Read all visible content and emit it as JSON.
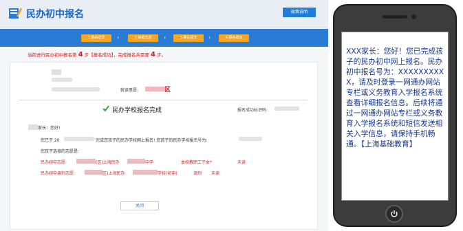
{
  "header": {
    "title": "民办初中报名",
    "help_button": "政策说明"
  },
  "steps": [
    {
      "label": "1.报名登录"
    },
    {
      "label": "2.填报志愿"
    },
    {
      "label": "3.确认提交"
    },
    {
      "label": "4.报名成功"
    }
  ],
  "status": {
    "prefix": "当前进行民办初中报名第",
    "current_step": "4",
    "middle": "步【报名成功】，完成报名共需要",
    "total_steps": "4",
    "suffix": "步。"
  },
  "card": {
    "district_label": "就读意愿:",
    "district_value": "区",
    "done_title": "民办学校报名完成",
    "id_label": "报名成功标识码:",
    "greeting": "家长：您好!",
    "success_prefix": "您已于 20",
    "success_text": "完成您孩子的民办学校网上报名! 您孩子的民办学校报名号为:",
    "choices_label": "您孩子选择的志愿是:",
    "choice1_label": "民办初中志愿:",
    "choice1_school_a": "(区)上海民办",
    "choice1_school_b": "中学",
    "choice1_extra": "本校教职工子女*",
    "choice1_action": "未读",
    "choice2_label": "民办初中调剂志愿:",
    "choice2_school_a": "区)上海民办",
    "choice2_school_b": "学校(初中)",
    "choice2_extra": "调剂",
    "choice2_action": "未读",
    "close_button": "关闭"
  },
  "phone": {
    "sms": "XXX家长：您好！您已完成孩子的民办初中网上报名。民办初中报名号为：XXXXXXXXXX，请及时登录一网通办网站专栏或义务教育入学报名系统查看详细报名信息。后续将通过一网通办网站专栏或义务教育入学报名系统和短信发送相关入学信息，请保持手机畅通。【上海基础教育】"
  },
  "colors": {
    "brand_blue": "#1a66c8",
    "step_bar": "#2a7bd3",
    "step_orange": "#f5a623",
    "alert_red": "#d42020",
    "sms_blue": "#1a3a8a",
    "success_green": "#3aa835"
  }
}
